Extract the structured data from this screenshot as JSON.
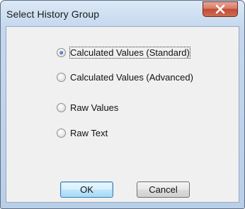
{
  "window": {
    "title": "Select History Group",
    "close_icon": "close-icon"
  },
  "options": [
    {
      "label": "Calculated Values (Standard)",
      "checked": true,
      "focused": true
    },
    {
      "label": "Calculated Values (Advanced)",
      "checked": false,
      "focused": false
    },
    {
      "label": "Raw Values",
      "checked": false,
      "focused": false
    },
    {
      "label": "Raw Text",
      "checked": false,
      "focused": false
    }
  ],
  "buttons": {
    "ok_label": "OK",
    "cancel_label": "Cancel"
  },
  "colors": {
    "accent": "#2a5fa8",
    "close_button": "#c14a33",
    "titlebar": "#c4d7ee"
  }
}
